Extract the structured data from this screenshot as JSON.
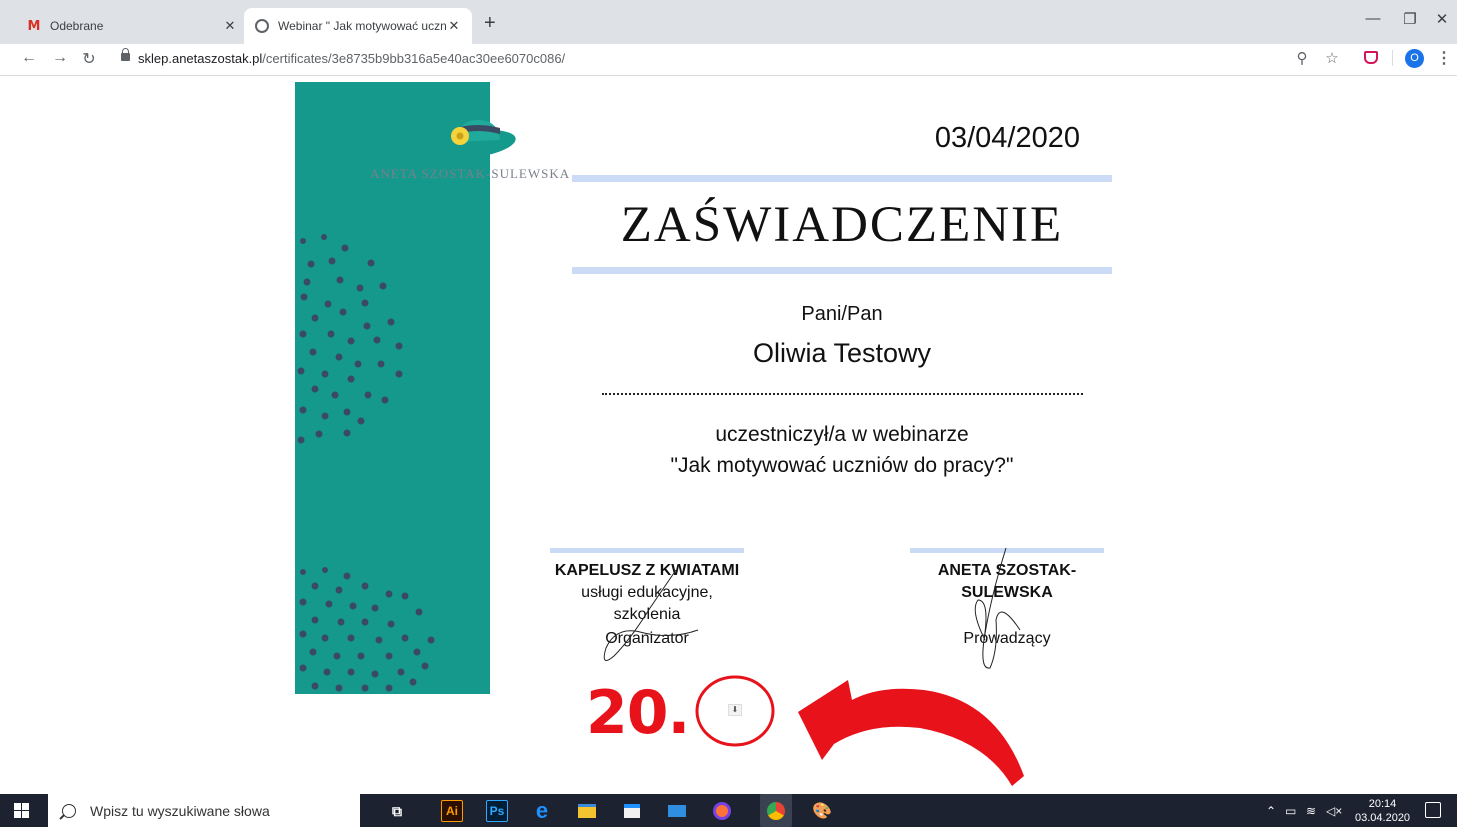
{
  "browser": {
    "tabs": [
      {
        "label": "Odebrane",
        "icon": "gmail-icon",
        "active": false
      },
      {
        "label": "Webinar \" Jak motywować uczniów",
        "icon": "globe-icon",
        "active": true
      }
    ],
    "url_domain": "sklep.anetaszostak.pl",
    "url_path": "/certificates/3e8735b9bb316a5e40ac30ee6070c086/",
    "profile_initial": "O"
  },
  "certificate": {
    "logo_text": "ANETA SZOSTAK-SULEWSKA",
    "date": "03/04/2020",
    "heading": "ZAŚWIADCZENIE",
    "salutation": "Pani/Pan",
    "recipient": "Oliwia Testowy",
    "participation": "uczestniczył/a w webinarze",
    "webinar_title": "\"Jak motywować uczniów do pracy?\"",
    "organizer": {
      "name": "KAPELUSZ Z KWIATAMI",
      "desc1": "usługi edukacyjne,",
      "desc2": "szkolenia",
      "role": "Organizator"
    },
    "host": {
      "name1": "ANETA SZOSTAK-",
      "name2": "SULEWSKA",
      "role": "Prowadzący"
    },
    "accent_color": "#16998d"
  },
  "annotation": {
    "step_number": "20.",
    "color": "#e8121a"
  },
  "taskbar": {
    "search_placeholder": "Wpisz tu wyszukiwane słowa",
    "time": "20:14",
    "date": "03.04.2020",
    "apps": [
      "task-view-icon",
      "illustrator-icon",
      "photoshop-icon",
      "edge-icon",
      "file-explorer-icon",
      "store-icon",
      "mail-icon",
      "firefox-icon",
      "chrome-icon",
      "paint-icon"
    ]
  }
}
